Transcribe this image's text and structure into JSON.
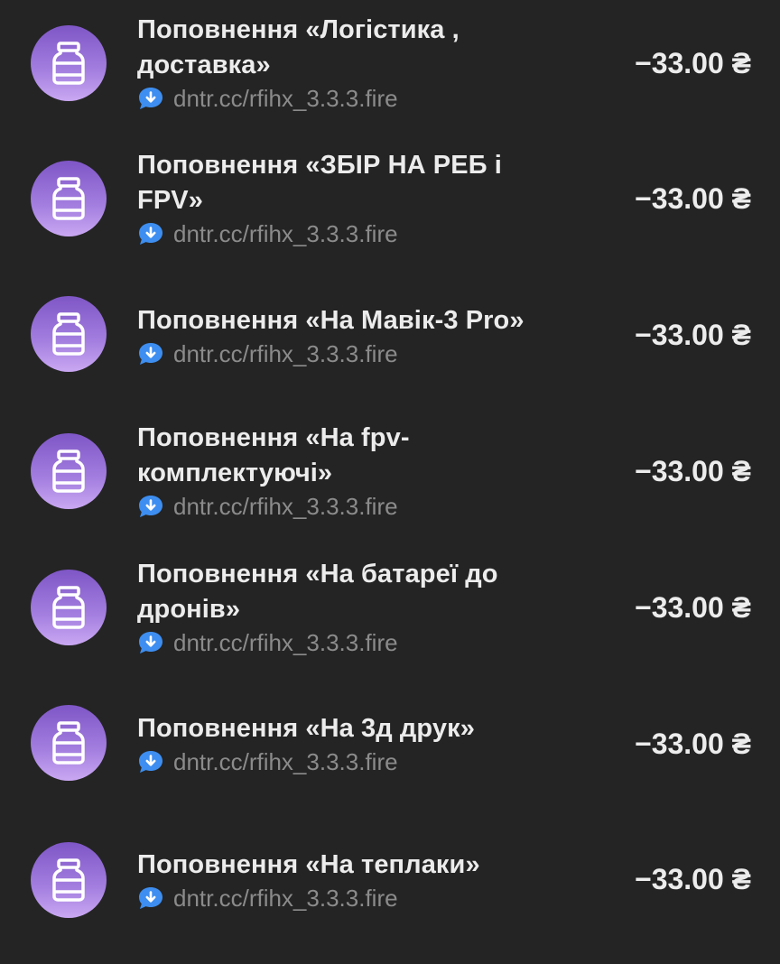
{
  "transactions": [
    {
      "title": "Поповнення «Логістика , доставка»",
      "subtitle": "dntr.cc/rfihx_3.3.3.fire",
      "amount": "−33.00 ₴"
    },
    {
      "title": "Поповнення «ЗБІР НА РЕБ і FPV»",
      "subtitle": "dntr.cc/rfihx_3.3.3.fire",
      "amount": "−33.00 ₴"
    },
    {
      "title": "Поповнення «На Мавік-3 Pro»",
      "subtitle": "dntr.cc/rfihx_3.3.3.fire",
      "amount": "−33.00 ₴"
    },
    {
      "title": "Поповнення «На fpv-комплектуючі»",
      "subtitle": "dntr.cc/rfihx_3.3.3.fire",
      "amount": "−33.00 ₴"
    },
    {
      "title": "Поповнення «На батареї до дронів»",
      "subtitle": "dntr.cc/rfihx_3.3.3.fire",
      "amount": "−33.00 ₴"
    },
    {
      "title": "Поповнення «На 3д друк»",
      "subtitle": "dntr.cc/rfihx_3.3.3.fire",
      "amount": "−33.00 ₴"
    },
    {
      "title": "Поповнення «На теплаки»",
      "subtitle": "dntr.cc/rfihx_3.3.3.fire",
      "amount": "−33.00 ₴"
    }
  ],
  "icons": {
    "avatar": "jar-icon",
    "subtitle": "comment-arrow-icon"
  },
  "colors": {
    "background": "#242424",
    "avatar_gradient_top": "#7f56c6",
    "avatar_gradient_bottom": "#caa8f2",
    "title": "#ececec",
    "subtitle": "#8b8b8b",
    "comment_icon": "#3d8ef0"
  }
}
